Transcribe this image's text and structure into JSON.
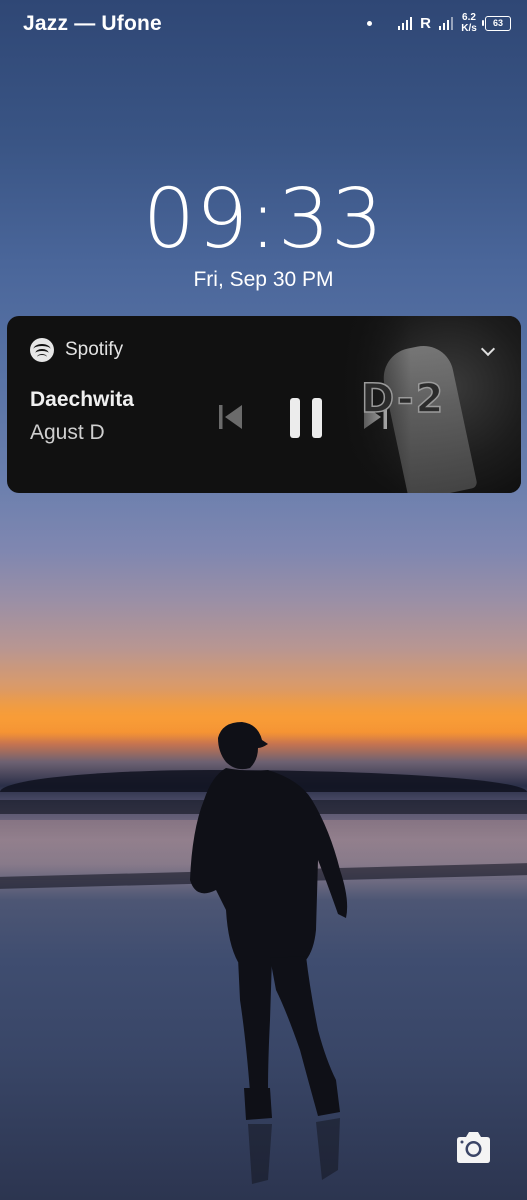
{
  "status_bar": {
    "carrier": "Jazz — Ufone",
    "network_label": "R",
    "speed_value": "6.2",
    "speed_unit": "K/s",
    "battery": "63"
  },
  "lockscreen": {
    "time": "09:33",
    "date": "Fri, Sep 30  PM"
  },
  "media_player": {
    "app_name": "Spotify",
    "track_title": "Daechwita",
    "artist": "Agust D",
    "album_art_text": "D-2",
    "state": "playing"
  },
  "shortcuts": {
    "camera_icon": "camera-icon"
  }
}
